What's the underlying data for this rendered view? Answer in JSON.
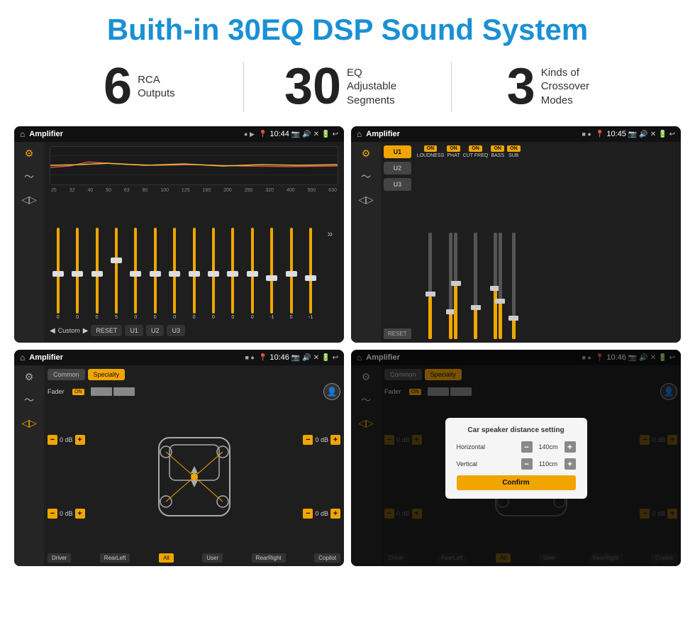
{
  "header": {
    "title": "Buith-in 30EQ DSP Sound System"
  },
  "stats": [
    {
      "number": "6",
      "desc_line1": "RCA",
      "desc_line2": "Outputs"
    },
    {
      "number": "30",
      "desc_line1": "EQ Adjustable",
      "desc_line2": "Segments"
    },
    {
      "number": "3",
      "desc_line1": "Kinds of",
      "desc_line2": "Crossover Modes"
    }
  ],
  "screens": {
    "eq_screen": {
      "app_name": "Amplifier",
      "time": "10:44",
      "freq_labels": [
        "25",
        "32",
        "40",
        "50",
        "63",
        "80",
        "100",
        "125",
        "160",
        "200",
        "250",
        "320",
        "400",
        "500",
        "630"
      ],
      "slider_values": [
        "0",
        "0",
        "0",
        "5",
        "0",
        "0",
        "0",
        "0",
        "0",
        "0",
        "0",
        "-1",
        "0",
        "-1"
      ],
      "bottom_buttons": [
        "Custom",
        "RESET",
        "U1",
        "U2",
        "U3"
      ]
    },
    "crossover_screen": {
      "app_name": "Amplifier",
      "time": "10:45",
      "presets": [
        "U1",
        "U2",
        "U3"
      ],
      "channels": [
        "LOUDNESS",
        "PHAT",
        "CUT FREQ",
        "BASS",
        "SUB"
      ],
      "channel_labels_on": [
        true,
        true,
        true,
        true,
        true
      ],
      "reset_label": "RESET"
    },
    "fader_screen": {
      "app_name": "Amplifier",
      "time": "10:46",
      "tabs": [
        "Common",
        "Specialty"
      ],
      "fader_label": "Fader",
      "on_label": "ON",
      "db_values": [
        "0 dB",
        "0 dB",
        "0 dB",
        "0 dB"
      ],
      "bottom_buttons": [
        "Driver",
        "RearLeft",
        "All",
        "User",
        "RearRight",
        "Copilot"
      ]
    },
    "distance_screen": {
      "app_name": "Amplifier",
      "time": "10:46",
      "tabs": [
        "Common",
        "Specialty"
      ],
      "dialog_title": "Car speaker distance setting",
      "horizontal_label": "Horizontal",
      "horizontal_value": "140cm",
      "vertical_label": "Vertical",
      "vertical_value": "110cm",
      "confirm_label": "Confirm",
      "db_values": [
        "0 dB",
        "0 dB"
      ],
      "bottom_buttons": [
        "Driver",
        "RearLeft",
        "All",
        "User",
        "RearRight",
        "Copilot"
      ]
    }
  }
}
